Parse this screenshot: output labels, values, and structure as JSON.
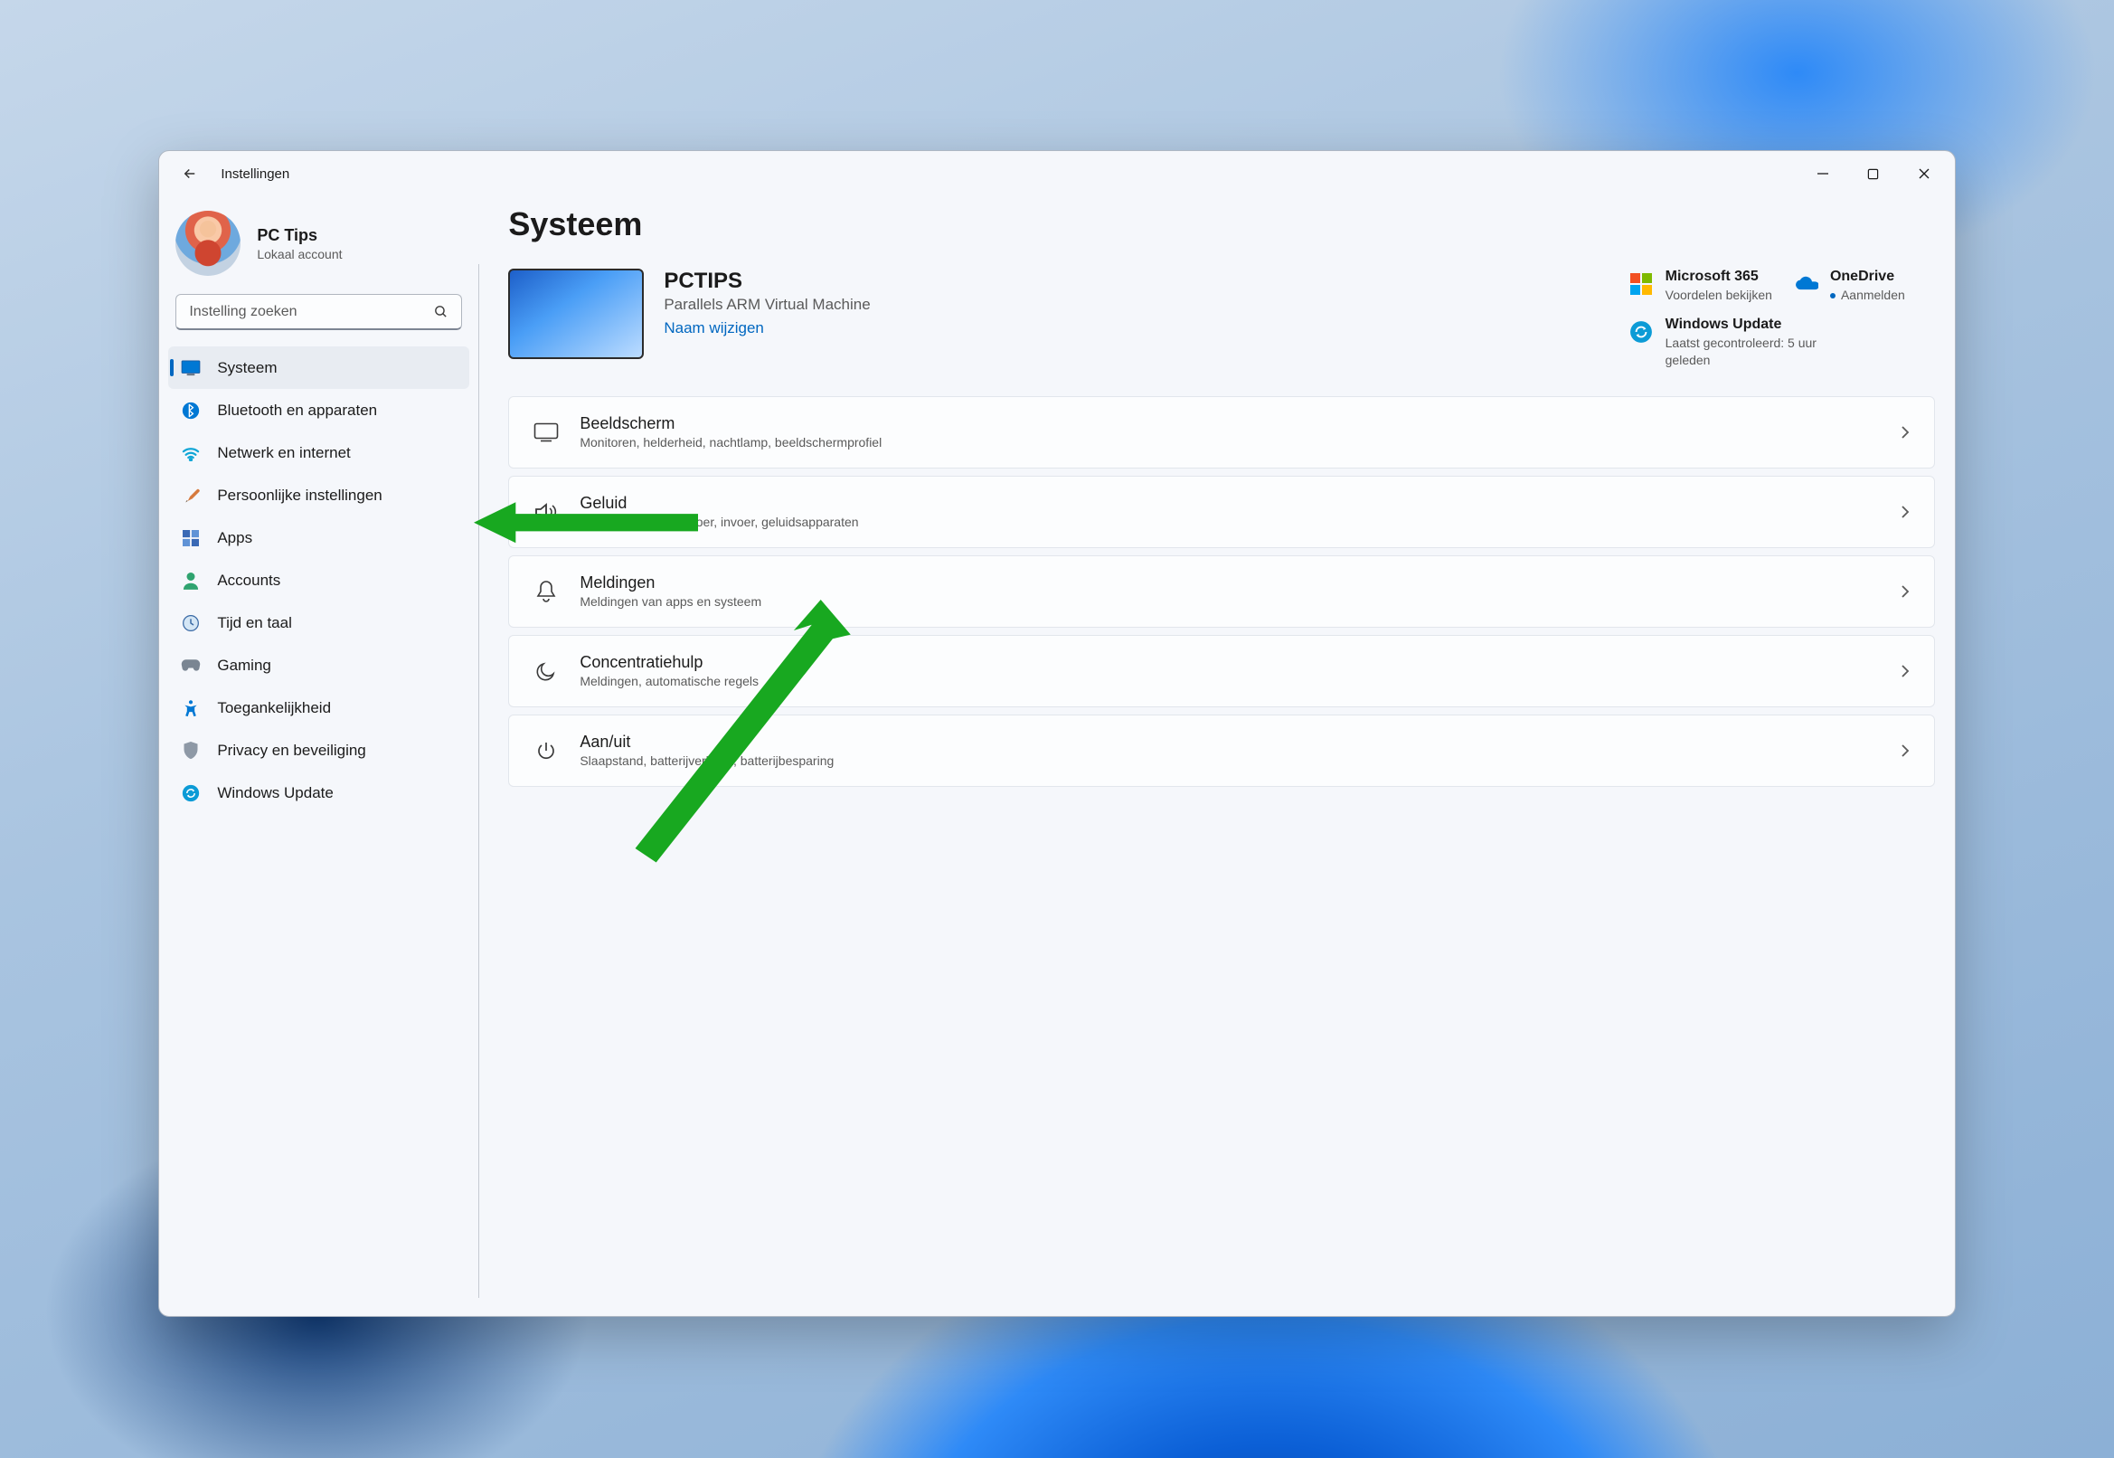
{
  "window": {
    "title": "Instellingen"
  },
  "profile": {
    "name": "PC Tips",
    "account_type": "Lokaal account"
  },
  "search": {
    "placeholder": "Instelling zoeken"
  },
  "sidebar": {
    "items": [
      {
        "id": "system",
        "label": "Systeem",
        "active": true
      },
      {
        "id": "bluetooth",
        "label": "Bluetooth en apparaten"
      },
      {
        "id": "network",
        "label": "Netwerk en internet"
      },
      {
        "id": "personalization",
        "label": "Persoonlijke instellingen"
      },
      {
        "id": "apps",
        "label": "Apps"
      },
      {
        "id": "accounts",
        "label": "Accounts"
      },
      {
        "id": "time",
        "label": "Tijd en taal"
      },
      {
        "id": "gaming",
        "label": "Gaming"
      },
      {
        "id": "accessibility",
        "label": "Toegankelijkheid"
      },
      {
        "id": "privacy",
        "label": "Privacy en beveiliging"
      },
      {
        "id": "update",
        "label": "Windows Update"
      }
    ]
  },
  "page": {
    "title": "Systeem",
    "pc": {
      "name": "PCTIPS",
      "model": "Parallels ARM Virtual Machine",
      "rename": "Naam wijzigen"
    },
    "tiles": {
      "m365": {
        "title": "Microsoft 365",
        "sub": "Voordelen bekijken"
      },
      "onedrive": {
        "title": "OneDrive",
        "sub": "Aanmelden"
      },
      "update": {
        "title": "Windows Update",
        "sub": "Laatst gecontroleerd: 5 uur geleden"
      }
    },
    "cards": [
      {
        "id": "display",
        "title": "Beeldscherm",
        "sub": "Monitoren, helderheid, nachtlamp, beeldschermprofiel"
      },
      {
        "id": "sound",
        "title": "Geluid",
        "sub": "Volume niveaus, uitvoer, invoer, geluidsapparaten"
      },
      {
        "id": "notifications",
        "title": "Meldingen",
        "sub": "Meldingen van apps en systeem"
      },
      {
        "id": "focus",
        "title": "Concentratiehulp",
        "sub": "Meldingen, automatische regels"
      },
      {
        "id": "power",
        "title": "Aan/uit",
        "sub": "Slaapstand, batterijverbruik, batterijbesparing"
      }
    ]
  }
}
